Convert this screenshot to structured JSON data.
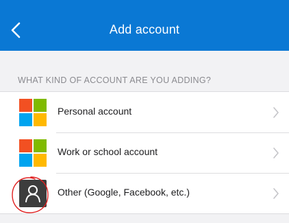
{
  "nav": {
    "title": "Add account",
    "back_icon": "chevron-left-icon"
  },
  "section": {
    "header": "WHAT KIND OF ACCOUNT ARE YOU ADDING?"
  },
  "accounts": [
    {
      "label": "Personal account",
      "icon": "microsoft-logo-icon"
    },
    {
      "label": "Work or school account",
      "icon": "microsoft-logo-icon"
    },
    {
      "label": "Other (Google, Facebook, etc.)",
      "icon": "person-icon"
    }
  ],
  "colors": {
    "nav_background": "#0a78d4",
    "ms_red": "#f25022",
    "ms_green": "#7fba00",
    "ms_blue": "#00a4ef",
    "ms_yellow": "#ffb900",
    "annotation": "#e02020"
  }
}
